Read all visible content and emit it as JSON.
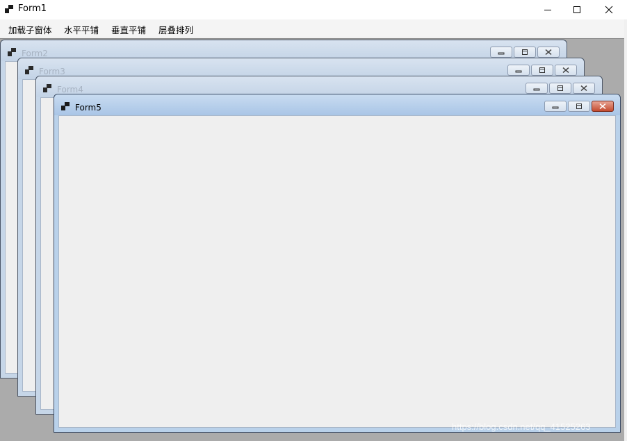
{
  "window": {
    "title": "Form1"
  },
  "menu": {
    "items": [
      "加载子窗体",
      "水平平铺",
      "垂直平铺",
      "层叠排列"
    ]
  },
  "children": [
    {
      "title": "Form2",
      "active": false
    },
    {
      "title": "Form3",
      "active": false
    },
    {
      "title": "Form4",
      "active": false
    },
    {
      "title": "Form5",
      "active": true
    }
  ],
  "watermark": "https://blog.csdn.net/qq_41525263",
  "colors": {
    "mdi_background": "#ababab",
    "child_frame": "#c6d6e8",
    "active_frame": "#b9d1ea",
    "close_button": "#c44a2e"
  },
  "icons": [
    "app-icon",
    "minimize-icon",
    "maximize-icon",
    "close-icon",
    "child-minimize-icon",
    "child-restore-icon",
    "child-close-icon"
  ]
}
